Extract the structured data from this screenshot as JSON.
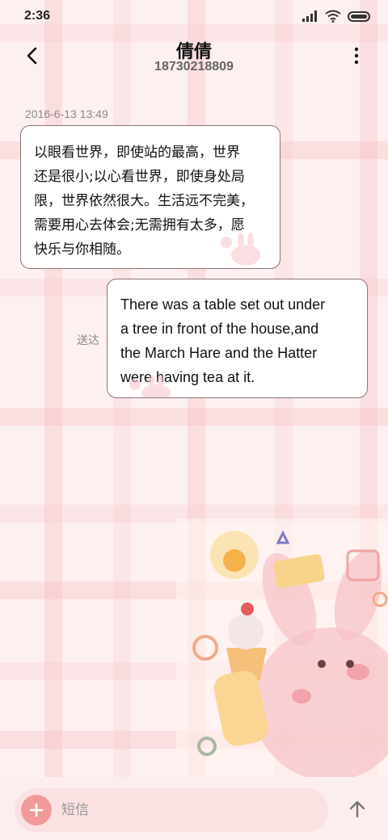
{
  "status_bar": {
    "time": "2:36",
    "icons": [
      "signal-icon",
      "wifi-icon",
      "battery-icon"
    ]
  },
  "header": {
    "contact_name": "倩倩",
    "contact_number": "18730218809",
    "back_icon": "chevron-left-icon",
    "menu_icon": "more-vertical-icon"
  },
  "conversation": {
    "timestamp": "2016-6-13 13:49",
    "incoming_message": {
      "lines": [
        "以眼看世界，即使站的最高，世界",
        "还是很小;以心看世界，即使身处局",
        "限，世界依然很大。生活远不完美，",
        "需要用心去体会;无需拥有太多，愿",
        "快乐与你相随。"
      ]
    },
    "outgoing_message": {
      "lines": [
        "There was a table set out under",
        "a tree in front of the house,and",
        "the March Hare and the Hatter",
        "were having tea at it."
      ],
      "status": "送达"
    }
  },
  "composer": {
    "placeholder": "短信",
    "add_icon": "plus-icon",
    "send_icon": "arrow-up-icon"
  },
  "colors": {
    "background": "#fdf0f0",
    "plaid_stripe": "#f6bec4",
    "bubble_border": "#8c7676",
    "add_button": "#f29a9a",
    "input_pill": "#fbe1e1"
  }
}
